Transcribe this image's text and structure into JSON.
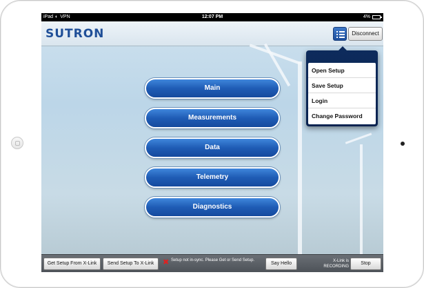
{
  "statusbar": {
    "carrier": "iPad",
    "vpn": "VPN",
    "time": "12:07 PM",
    "battery": "4%"
  },
  "header": {
    "logo": "SUTRON",
    "disconnect_label": "Disconnect"
  },
  "main_menu": [
    "Main",
    "Measurements",
    "Data",
    "Telemetry",
    "Diagnostics"
  ],
  "dropdown": [
    "Open Setup",
    "Save Setup",
    "Login",
    "Change Password"
  ],
  "bottombar": {
    "get_setup_label": "Get Setup From X-Link",
    "send_setup_label": "Send Setup To X-Link",
    "sync_status": "Setup not in-sync. Please Get or Send Setup.",
    "say_hello_label": "Say Hello",
    "recording_status": "X-Link is RECORDING",
    "stop_label": "Stop"
  },
  "colors": {
    "accent": "#1f5cb5",
    "logo": "#1f4f98",
    "error": "#e02020"
  }
}
